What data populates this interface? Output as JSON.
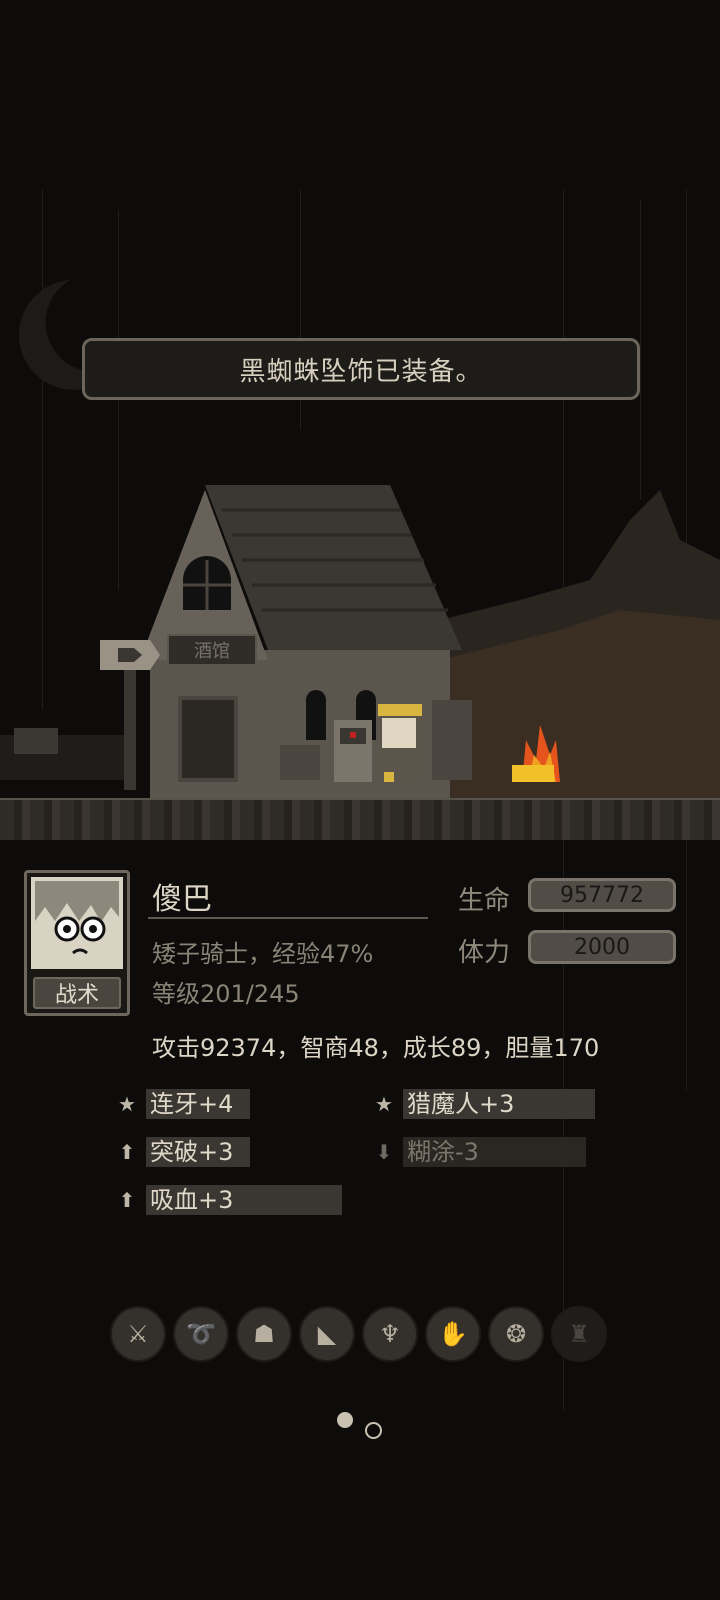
{
  "toast": {
    "message": "黑蜘蛛坠饰已装备。"
  },
  "scene": {
    "sign_text": "酒馆"
  },
  "character": {
    "name": "傻巴",
    "class_exp": "矮子骑士，经验47%",
    "level": "等级201/245",
    "tactic_button": "战术",
    "attributes": "攻击92374，智商48，成长89，胆量170"
  },
  "stats": {
    "hp_label": "生命",
    "hp_value": "957772",
    "stamina_label": "体力",
    "stamina_value": "2000"
  },
  "traits": [
    {
      "icon": "star-icon",
      "label": "连牙+4"
    },
    {
      "icon": "star-icon",
      "label": "猎魔人+3"
    },
    {
      "icon": "arrow-up-icon",
      "label": "突破+3"
    },
    {
      "icon": "arrow-down-icon",
      "label": "糊涂-3"
    },
    {
      "icon": "arrow-up-icon",
      "label": "吸血+3"
    }
  ],
  "equipment": [
    {
      "icon": "sword-icon"
    },
    {
      "icon": "whip-icon"
    },
    {
      "icon": "helmet-icon"
    },
    {
      "icon": "boot-icon"
    },
    {
      "icon": "cloak-icon"
    },
    {
      "icon": "gloves-icon"
    },
    {
      "icon": "necklace-icon"
    },
    {
      "icon": "empty-slot-icon"
    }
  ],
  "pager": {
    "current_page": 1,
    "total_pages": 2
  },
  "colors": {
    "fire": "#f0a020",
    "panel_bg": "#0d0c0b",
    "text": "#ddd6c6"
  }
}
